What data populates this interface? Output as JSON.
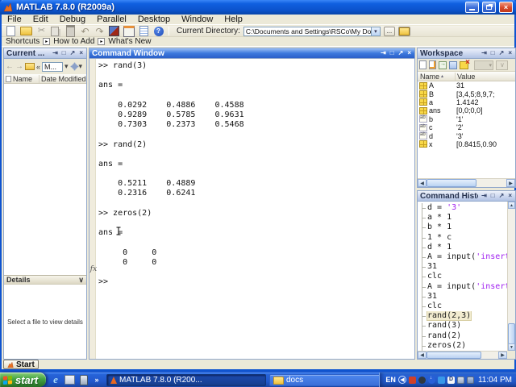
{
  "titlebar": {
    "title": "MATLAB  7.8.0 (R2009a)",
    "close_glyph": "×"
  },
  "menu": {
    "items": [
      {
        "label": "File",
        "name": "menu-file"
      },
      {
        "label": "Edit",
        "name": "menu-edit"
      },
      {
        "label": "Debug",
        "name": "menu-debug"
      },
      {
        "label": "Parallel",
        "name": "menu-parallel"
      },
      {
        "label": "Desktop",
        "name": "menu-desktop"
      },
      {
        "label": "Window",
        "name": "menu-window"
      },
      {
        "label": "Help",
        "name": "menu-help"
      }
    ]
  },
  "toolbar": {
    "icons": [
      {
        "name": "new-file-icon",
        "kind": "ic-new",
        "glyph": ""
      },
      {
        "name": "open-folder-icon",
        "kind": "ic-open",
        "glyph": ""
      },
      {
        "name": "cut-icon",
        "kind": "ic-cut",
        "glyph": "✂"
      },
      {
        "name": "copy-icon",
        "kind": "ic-copy",
        "glyph": ""
      },
      {
        "name": "paste-icon",
        "kind": "ic-paste",
        "glyph": ""
      },
      {
        "name": "undo-icon",
        "kind": "ic-undo",
        "glyph": "↶"
      },
      {
        "name": "redo-icon",
        "kind": "ic-redo",
        "glyph": "↷"
      },
      {
        "name": "simulink-icon",
        "kind": "ic-simulink",
        "glyph": ""
      },
      {
        "name": "guide-icon",
        "kind": "ic-guide",
        "glyph": ""
      },
      {
        "name": "editor-icon",
        "kind": "ic-editor",
        "glyph": ""
      },
      {
        "name": "help-icon",
        "kind": "ic-help",
        "glyph": ""
      }
    ],
    "current_directory_label": "Current Directory:",
    "current_directory_value": "C:\\Documents and Settings\\RSCo\\My Documents\\MATLAB",
    "combo_arrow": "▾",
    "browse_label": "...",
    "up_folder": ""
  },
  "shortcuts": {
    "label": "Shortcuts",
    "items": [
      {
        "label": "How to Add",
        "name": "shortcut-how-to-add"
      },
      {
        "label": "What's New",
        "name": "shortcut-whats-new"
      }
    ]
  },
  "panel_controls": {
    "dock": "⇥",
    "maximize": "□",
    "undock": "↗",
    "close": "×"
  },
  "current_folder": {
    "title": "Current ...",
    "toolbar_icons": [
      {
        "name": "back-icon",
        "kind": "cdi-arrow",
        "glyph": "←"
      },
      {
        "name": "forward-icon",
        "kind": "cdi-arrow",
        "glyph": "→"
      },
      {
        "name": "folder-icon",
        "kind": "cdi-folder",
        "glyph": ""
      },
      {
        "name": "overflow-chevron-icon",
        "kind": "cdi-text",
        "glyph": "«"
      },
      {
        "name": "directory-combo",
        "kind": "cdi-combo",
        "glyph": "M..."
      },
      {
        "name": "combo-arrow-icon",
        "kind": "cdi-text",
        "glyph": "▾"
      },
      {
        "name": "actions-gear-icon",
        "kind": "cdi-gear",
        "glyph": ""
      },
      {
        "name": "gear-arrow-icon",
        "kind": "cdi-text",
        "glyph": "▾"
      }
    ],
    "columns": {
      "name": "Name",
      "date": "Date Modified"
    },
    "details_header": "Details",
    "collapse_glyph": "∨",
    "details_empty": "Select a file to view details"
  },
  "command_window": {
    "title": "Command Window",
    "fx_label": "fx",
    "lines": [
      ">> rand(3)",
      "",
      "ans =",
      "",
      "    0.0292    0.4886    0.4588",
      "    0.9289    0.5785    0.9631",
      "    0.7303    0.2373    0.5468",
      "",
      ">> rand(2)",
      "",
      "ans =",
      "",
      "    0.5211    0.4889",
      "    0.2316    0.6241",
      "",
      ">> zeros(2)",
      "",
      "ans =",
      "",
      "     0     0",
      "     0     0",
      "",
      ">>"
    ]
  },
  "workspace": {
    "title": "Workspace",
    "toolbar_icons": [
      {
        "name": "new-variable-icon",
        "kind": "wic-new"
      },
      {
        "name": "open-variable-icon",
        "kind": "wic-edit"
      },
      {
        "name": "import-data-icon",
        "kind": "wic-import"
      },
      {
        "name": "save-workspace-icon",
        "kind": "wic-save"
      },
      {
        "name": "delete-variable-icon",
        "kind": "wic-del"
      },
      {
        "name": "plot-selector-disabled",
        "kind": "wic-plot"
      },
      {
        "name": "plot-apply-disabled",
        "kind": "wic-plot2"
      }
    ],
    "columns": {
      "name": "Name",
      "value": "Value"
    },
    "sort_glyph": "▴",
    "rows": [
      {
        "icon": "matrix",
        "name": "A",
        "value": "31"
      },
      {
        "icon": "matrix",
        "name": "B",
        "value": "[3,4,5;8,9,7;"
      },
      {
        "icon": "matrix",
        "name": "a",
        "value": "1.4142"
      },
      {
        "icon": "matrix",
        "name": "ans",
        "value": "[0,0;0,0]"
      },
      {
        "icon": "char",
        "name": "b",
        "value": "'1'"
      },
      {
        "icon": "char",
        "name": "c",
        "value": "'2'"
      },
      {
        "icon": "char",
        "name": "d",
        "value": "'3'"
      },
      {
        "icon": "matrix",
        "name": "x",
        "value": "[0.8415,0.90"
      }
    ]
  },
  "command_history": {
    "title": "Command History",
    "items": [
      {
        "pre": "d = ",
        "str": "'3'",
        "state": ""
      },
      {
        "pre": "a * 1",
        "str": "",
        "state": ""
      },
      {
        "pre": "b * 1",
        "str": "",
        "state": ""
      },
      {
        "pre": "1 * c",
        "str": "",
        "state": ""
      },
      {
        "pre": "d * 1",
        "str": "",
        "state": ""
      },
      {
        "pre": "A = input(",
        "str": "'insert",
        "state": ""
      },
      {
        "pre": "31",
        "str": "",
        "state": ""
      },
      {
        "pre": "clc",
        "str": "",
        "state": ""
      },
      {
        "pre": "A = input(",
        "str": "'insert",
        "state": ""
      },
      {
        "pre": "31",
        "str": "",
        "state": ""
      },
      {
        "pre": "clc",
        "str": "",
        "state": ""
      },
      {
        "pre": "rand(2,3)",
        "str": "",
        "state": "hl"
      },
      {
        "pre": "rand(3)",
        "str": "",
        "state": ""
      },
      {
        "pre": "rand(2)",
        "str": "",
        "state": ""
      },
      {
        "pre": "zeros(2)",
        "str": "",
        "state": ""
      }
    ]
  },
  "scroll_glyphs": {
    "left": "◀",
    "right": "▶",
    "up": "▲",
    "down": "▼"
  },
  "matlab_start": {
    "label": "Start"
  },
  "taskbar": {
    "start_label": "start",
    "quicklaunch": [
      {
        "name": "ie-launcher-icon",
        "kind": "ql-ie",
        "glyph": "e"
      },
      {
        "name": "show-desktop-icon",
        "kind": "ql-desk",
        "glyph": ""
      },
      {
        "name": "messenger-icon",
        "kind": "ql-msn",
        "glyph": ""
      }
    ],
    "overflow_glyph": "»",
    "tasks": [
      {
        "label": "MATLAB  7.8.0 (R200...",
        "cls": "active",
        "icon": "matlab",
        "name": "taskbar-task-matlab"
      },
      {
        "label": "docs",
        "cls": "norm",
        "icon": "folder",
        "name": "taskbar-task-docs"
      }
    ],
    "tray": {
      "lang": "EN",
      "chevron": "◀",
      "icons": [
        {
          "name": "tray-icon-red-shield",
          "kind": "tri-1"
        },
        {
          "name": "tray-icon-dark-badge",
          "kind": "tri-2"
        },
        {
          "name": "tray-icon-update-arrow",
          "kind": "tri-3"
        },
        {
          "name": "tray-icon-blue-badge",
          "kind": "tri-4"
        },
        {
          "name": "tray-icon-letter-d",
          "kind": "tri-5"
        },
        {
          "name": "tray-icon-dual-monitor",
          "kind": "tri-6"
        },
        {
          "name": "tray-icon-network",
          "kind": "tri-7"
        }
      ],
      "time": "11:04 PM"
    }
  }
}
